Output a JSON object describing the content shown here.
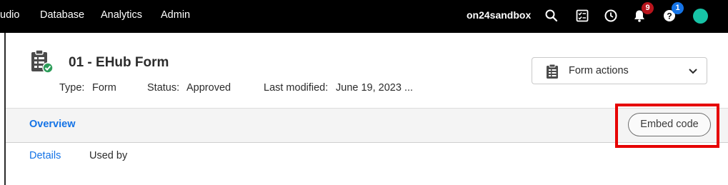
{
  "topnav": {
    "items": [
      "udio",
      "Database",
      "Analytics",
      "Admin"
    ],
    "org": "on24sandbox",
    "notifications_count": "9",
    "help_count": "1",
    "icons": [
      "search-icon",
      "tasks-icon",
      "clock-icon",
      "bell-icon",
      "help-icon",
      "avatar"
    ]
  },
  "header": {
    "title": "01 - EHub Form",
    "type_label": "Type:",
    "type_value": "Form",
    "status_label": "Status:",
    "status_value": "Approved",
    "modified_label": "Last modified:",
    "modified_value": "June 19, 2023 ...",
    "actions_label": "Form actions"
  },
  "tabs": {
    "overview": "Overview",
    "embed_label": "Embed code"
  },
  "subtabs": {
    "details": "Details",
    "used_by": "Used by"
  },
  "colors": {
    "accent": "#1473e6",
    "highlight": "#e60000",
    "notification_badge": "#b8141c",
    "help_badge": "#1473e6",
    "avatar": "#17c3a6",
    "status_check": "#2d9d5a"
  }
}
